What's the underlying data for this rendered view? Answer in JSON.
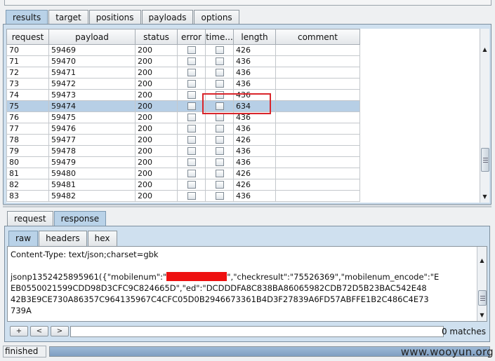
{
  "main_tabs": [
    {
      "label": "results",
      "active": true
    },
    {
      "label": "target",
      "active": false
    },
    {
      "label": "positions",
      "active": false
    },
    {
      "label": "payloads",
      "active": false
    },
    {
      "label": "options",
      "active": false
    }
  ],
  "table": {
    "columns": [
      "request",
      "payload",
      "status",
      "error",
      "time...",
      "length",
      "comment"
    ],
    "rows": [
      {
        "request": "70",
        "payload": "59469",
        "status": "200",
        "length": "426",
        "selected": false
      },
      {
        "request": "71",
        "payload": "59470",
        "status": "200",
        "length": "436",
        "selected": false
      },
      {
        "request": "72",
        "payload": "59471",
        "status": "200",
        "length": "436",
        "selected": false
      },
      {
        "request": "73",
        "payload": "59472",
        "status": "200",
        "length": "436",
        "selected": false
      },
      {
        "request": "74",
        "payload": "59473",
        "status": "200",
        "length": "436",
        "selected": false
      },
      {
        "request": "75",
        "payload": "59474",
        "status": "200",
        "length": "634",
        "selected": true
      },
      {
        "request": "76",
        "payload": "59475",
        "status": "200",
        "length": "436",
        "selected": false
      },
      {
        "request": "77",
        "payload": "59476",
        "status": "200",
        "length": "436",
        "selected": false
      },
      {
        "request": "78",
        "payload": "59477",
        "status": "200",
        "length": "426",
        "selected": false
      },
      {
        "request": "79",
        "payload": "59478",
        "status": "200",
        "length": "436",
        "selected": false
      },
      {
        "request": "80",
        "payload": "59479",
        "status": "200",
        "length": "436",
        "selected": false
      },
      {
        "request": "81",
        "payload": "59480",
        "status": "200",
        "length": "426",
        "selected": false
      },
      {
        "request": "82",
        "payload": "59481",
        "status": "200",
        "length": "426",
        "selected": false
      },
      {
        "request": "83",
        "payload": "59482",
        "status": "200",
        "length": "436",
        "selected": false
      }
    ]
  },
  "req_resp_tabs": [
    {
      "label": "request",
      "active": false
    },
    {
      "label": "response",
      "active": true
    }
  ],
  "view_tabs": [
    {
      "label": "raw",
      "active": true
    },
    {
      "label": "headers",
      "active": false
    },
    {
      "label": "hex",
      "active": false
    }
  ],
  "response_text": {
    "line1": "Content-Type: text/json;charset=gbk",
    "line2": "",
    "line3_pre": "jsonp1352425895961({\"mobilenum\":\"",
    "line3_post": "\",\"checkresult\":\"75526369\",\"mobilenum_encode\":\"E",
    "line4": "EB0550021599CDD98D3CFC9C824665D\",\"ed\":\"DCDDDFA8C838BA86065982CDB72D5B23BAC542E48",
    "line5": "42B3E9CE730A86357C964135967C4CFC05D0B2946673361B4D3F27839A6FD57ABFFE1B2C486C4E73",
    "line6": "739A"
  },
  "search": {
    "prev_label": "+",
    "back_label": "<",
    "next_label": ">",
    "value": "",
    "matches": "0 matches"
  },
  "status": {
    "text": "finished",
    "progress": 1.0
  },
  "watermark": "www.wooyun.org",
  "colors": {
    "selected_row": "#b7cfe6",
    "highlight_box": "#d9252b",
    "redaction": "#ee1111"
  }
}
